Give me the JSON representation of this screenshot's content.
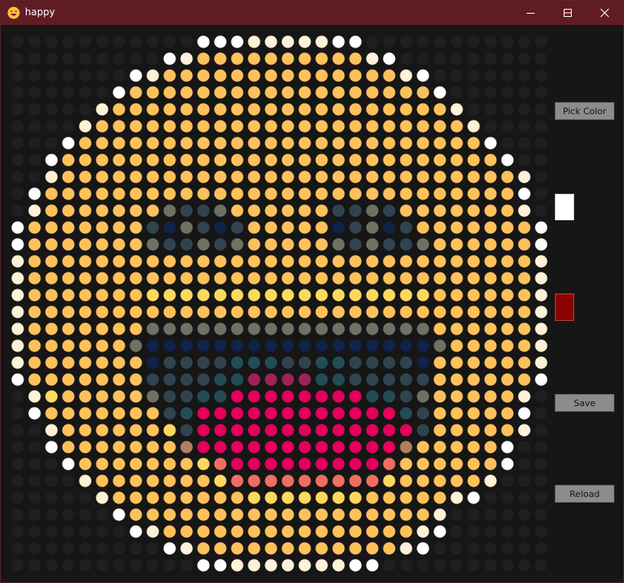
{
  "window": {
    "title": "happy",
    "icon": "smiling-face-icon"
  },
  "controls": {
    "minimize_icon": "minimize-icon",
    "maximize_icon": "maximize-icon",
    "close_icon": "close-icon"
  },
  "sidebar": {
    "pick_color_label": "Pick Color",
    "save_label": "Save",
    "reload_label": "Reload",
    "primary_color": "#ffffff",
    "secondary_color": "#8b0000"
  },
  "pixel_grid": {
    "rows": 32,
    "cols": 32,
    "legend": {
      ".": "#1f1f1f",
      "W": "#ffffff",
      "C": "#fff1d7",
      "O": "#fdc15c",
      "Y": "#fcd95e",
      "N": "#0e2448",
      "G": "#6e7262",
      "T": "#324350",
      "K": "#214e55",
      "P": "#e4005c",
      "M": "#9f2354",
      "S": "#ee6e64",
      "B": "#b07e62"
    },
    "pixels": [
      "...........WWWCCCCCWW...........",
      ".........WCOOOOOOOOOOCW.........",
      ".......WCOOOOOOOOOOOOOOCW.......",
      "......WOOOOOOOOOOOOOOOOOOW......",
      ".....COOOOOOOOOOOOOOOOOOOOC.....",
      "....COOOOOOOOOOOOOOOOOOOOOOC....",
      "...WOOOOOOOOOOOOOOOOOOOOOOOOW...",
      "..WOOOOOOOOOOOOOOOOOOOOOOOOOOW..",
      "..COOOOOOOOOOOOOOOOOOOOOOOOOOOC.",
      ".WOOOOOOOOOOOOOOOOOOOOOOOOOOOOW.",
      ".COOOOOOOGTTGOOOOOOTTGTOOOOOOOC.",
      "WOOOOOOOTNGTNTOOOOONTGNTOOOOOOOW",
      "WOOOOOOOGTTGTGOOOOOGTGTTGOOOOOOW",
      "COOOOOOOOOOOOOOOOOOOOOOOOOOOOOOC",
      "COOOOOOOOOOOOOOOOOOOOOOOOOOOOOOC",
      "COOOOOOOYYYYYYYYYYYYYYYYYOOOOOOC",
      "COOOOOOOOOOOOOOOOOOOOOOOOOOOOOOC",
      "COOOOOOOGGGGGGGGGGGGGGGGGOOOOOOC",
      "COOOOOOGNNNNNNNNNNNNNNNNNGOOOOOC",
      "COOOOOOONTTTTKKKTTKKTTTTNOOOOOOC",
      "WOOOOOOOTTTTKKMMMMKKTTTTTOOOOOOW",
      ".CYOOOOOGTTKKPPPPPPPPKKTGOOOOOC.",
      ".WOOOOOOOTKPPPPPPPPPPPPKTOOOOOW.",
      "..COOOOOOYTPPPPPPPPPPPPPTOOOOOC.",
      "..WOOOOOOOBPPPPPPPPPPPPBOOOOOW..",
      "...WOOOOOOOYSPPPPPPPPPSOOOOOOW..",
      "....COOOOOOOYSSSSSSSSSYOOOOOC...",
      ".....COOOOOOOOYYYYYYYOOOOOCW....",
      "......WOOOOOOOOOOOOOOOOOOC......",
      ".......WCOOOOOOOOOOOOOOOCW......",
      ".........WCOOOOOOOOOOOOCW.......",
      "...........WWCCCCCCCWW.........."
    ]
  }
}
